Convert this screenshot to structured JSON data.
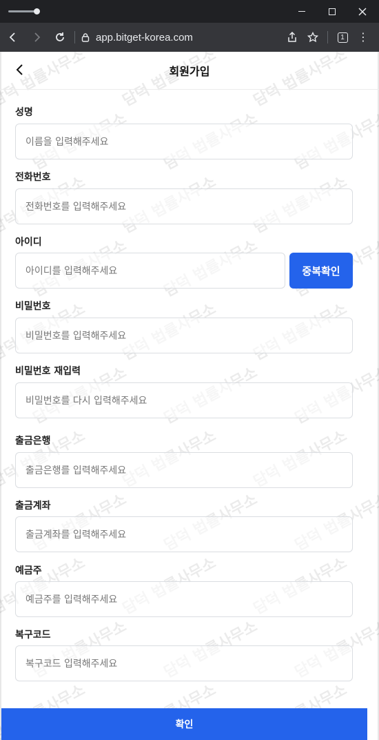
{
  "browser": {
    "url": "app.bitget-korea.com",
    "tab_count": "1"
  },
  "page": {
    "title": "회원가입",
    "watermark_text": "담덕 법률사무소"
  },
  "form": {
    "name": {
      "label": "성명",
      "placeholder": "이름을 입력해주세요"
    },
    "phone": {
      "label": "전화번호",
      "placeholder": "전화번호를 입력해주세요"
    },
    "userid": {
      "label": "아이디",
      "placeholder": "아이디를 입력해주세요",
      "check_button": "중복확인"
    },
    "password": {
      "label": "비밀번호",
      "placeholder": "비밀번호를 입력해주세요"
    },
    "password_confirm": {
      "label": "비밀번호 재입력",
      "placeholder": "비밀번호를 다시 입력해주세요"
    },
    "bank": {
      "label": "출금은행",
      "placeholder": "출금은행를 입력해주세요"
    },
    "account": {
      "label": "출금계좌",
      "placeholder": "출금계좌를 입력해주세요"
    },
    "holder": {
      "label": "예금주",
      "placeholder": "예금주를 입력해주세요"
    },
    "recovery": {
      "label": "복구코드",
      "placeholder": "복구코드 입력해주세요"
    },
    "submit": "확인"
  },
  "colors": {
    "primary": "#2463eb"
  }
}
